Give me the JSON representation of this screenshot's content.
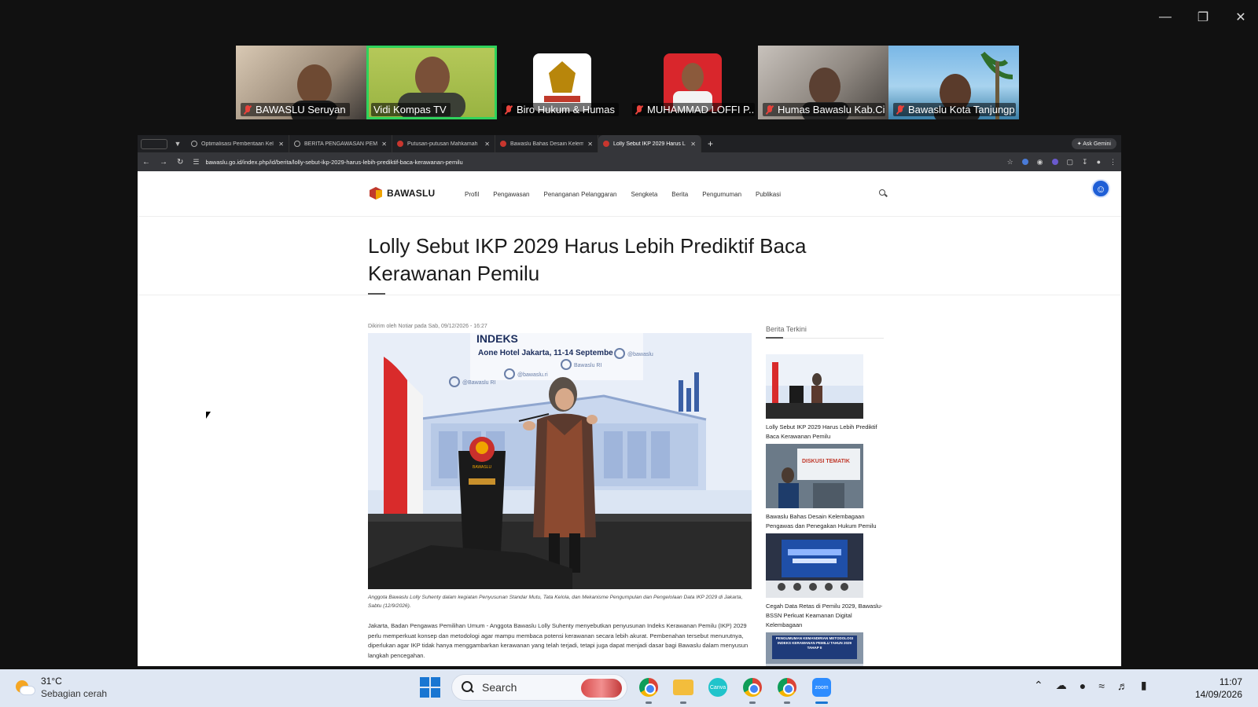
{
  "participants": [
    {
      "name": "BAWASLU Seruyan",
      "muted": true,
      "active": false
    },
    {
      "name": "Vidi Kompas TV",
      "muted": false,
      "active": true
    },
    {
      "name": "Biro Hukum & Humas",
      "muted": true,
      "active": false
    },
    {
      "name": "MUHAMMAD LOFFI P...",
      "muted": true,
      "active": false
    },
    {
      "name": "Humas Bawaslu Kab.Ci...",
      "muted": true,
      "active": false
    },
    {
      "name": "Bawaslu Kota Tanjungp...",
      "muted": true,
      "active": false
    }
  ],
  "browser": {
    "tabs": [
      {
        "title": "Optimalisasi Pemberitaan Kel",
        "active": false
      },
      {
        "title": "BERITA PENGAWASAN PEMI",
        "active": false
      },
      {
        "title": "Putusan-putusan Mahkamah",
        "active": false
      },
      {
        "title": "Bawaslu Bahas Desain Kelem",
        "active": false
      },
      {
        "title": "Lolly Sebut IKP 2029 Harus L",
        "active": true
      }
    ],
    "new_tab": "+",
    "ask_gemini": "Ask Gemini",
    "url": "bawaslu.go.id/index.php/id/berita/lolly-sebut-ikp-2029-harus-lebih-prediktif-baca-kerawanan-pemilu"
  },
  "site": {
    "logo_text": "BAWASLU",
    "nav": [
      "Profil",
      "Pengawasan",
      "Penanganan Pelanggaran",
      "Sengketa",
      "Berita",
      "Pengumuman",
      "Publikasi"
    ],
    "title": "Lolly Sebut IKP 2029 Harus Lebih Prediktif Baca Kerawanan Pemilu",
    "meta": "Dikirim oleh Notiar pada Sab, 09/12/2026 - 16:27",
    "photo_banner": {
      "heading": "INDEKS",
      "venue": "Aone Hotel Jakarta, 11-14 Septembe",
      "handles": [
        "@Bawaslu RI",
        "@bawaslu.ri",
        "Bawaslu RI",
        "@bawaslu"
      ],
      "podium_label": "BAWASLU"
    },
    "caption": "Anggota Bawaslu Lolly Suhenty dalam kegiatan Penyusunan Standar Mutu, Tata Kelola, dan Mekanisme Pengumpulan dan Pengelolaan Data IKP 2029 di Jakarta, Sabtu (12/9/2026).",
    "body": "Jakarta, Badan Pengawas Pemilihan Umum - Anggota Bawaslu Lolly Suhenty menyebutkan penyusunan Indeks Kerawanan Pemilu (IKP) 2029 perlu memperkuat konsep dan metodologi agar mampu membaca potensi kerawanan secara lebih akurat. Pembenahan tersebut menurutnya, diperlukan agar IKP tidak hanya menggambarkan kerawanan yang telah terjadi, tetapi juga dapat menjadi dasar bagi Bawaslu dalam menyusun langkah pencegahan.",
    "sidebar": {
      "heading": "Berita Terkini",
      "items": [
        {
          "caption": "Lolly Sebut IKP 2029 Harus Lebih Prediktif Baca Kerawanan Pemilu"
        },
        {
          "caption": "Bawaslu Bahas Desain Kelembagaan Pengawas dan Penegakan Hukum Pemilu",
          "thumb_text": "DISKUSI TEMATIK"
        },
        {
          "caption": "Cegah Data Retas di Pemilu 2029, Bawaslu-BSSN Perkuat Keamanan Digital Kelembagaan"
        },
        {
          "caption": "",
          "thumb_text": "PENGUMUMAN KEMANDIRIAN METODOLOGI INDEKS KERAWANAN PEMILU TAHUN 2029 TAHAP II"
        }
      ]
    }
  },
  "taskbar": {
    "temperature": "31°C",
    "condition": "Sebagian cerah",
    "search_label": "Search",
    "apps": [
      {
        "name": "chrome-icon",
        "label": ""
      },
      {
        "name": "file-explorer-icon",
        "label": ""
      },
      {
        "name": "canva-icon",
        "label": "Canva"
      },
      {
        "name": "chrome-profile-icon",
        "label": ""
      },
      {
        "name": "chrome-alt-icon",
        "label": ""
      },
      {
        "name": "zoom-icon",
        "label": "zoom"
      }
    ],
    "time": "11:07",
    "date": "14/09/2026"
  }
}
